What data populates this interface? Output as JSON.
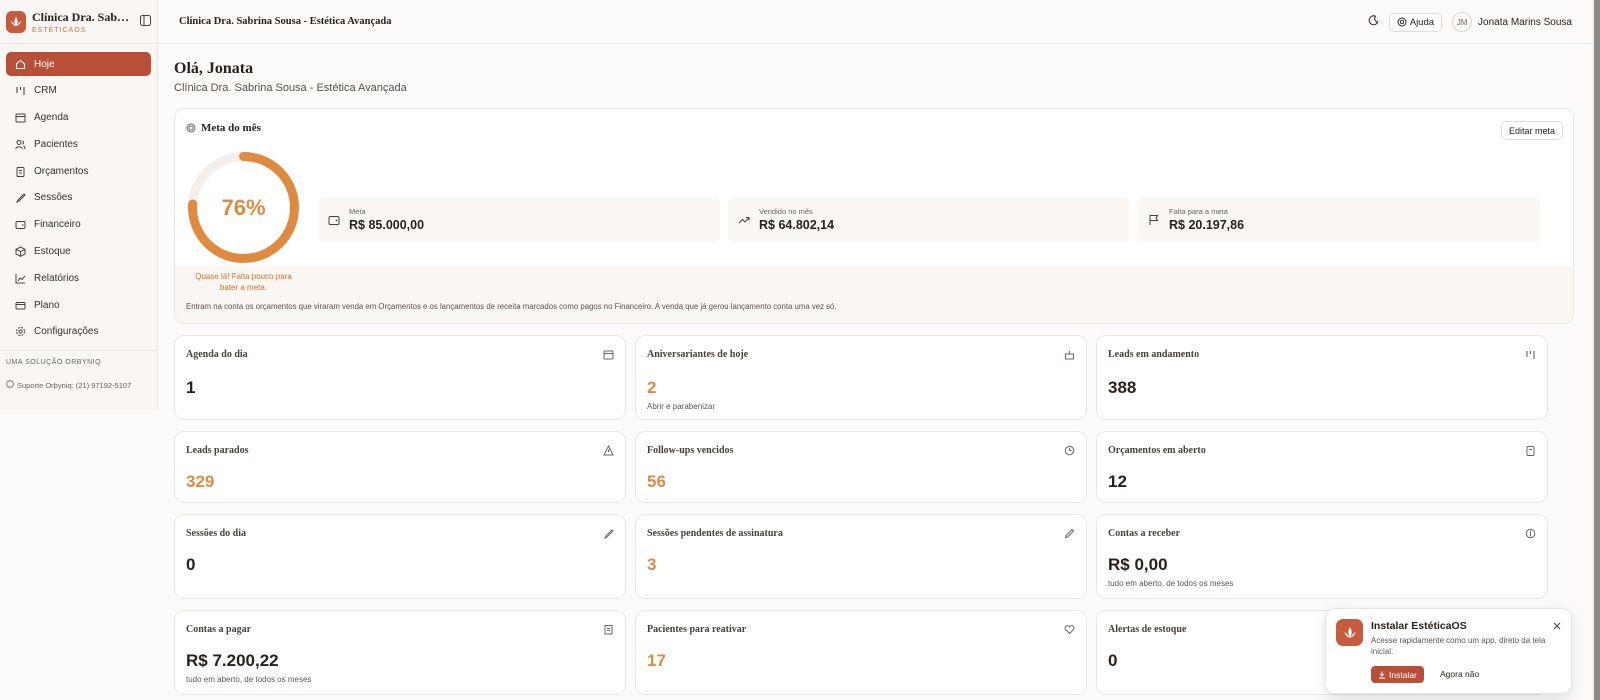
{
  "brand": {
    "name": "Clínica Dra. Sabrina Sousa",
    "sub": "ESTÉTICAOS"
  },
  "sidebar": {
    "items": [
      {
        "label": "Hoje",
        "icon": "home-icon",
        "active": true
      },
      {
        "label": "CRM",
        "icon": "kanban-icon"
      },
      {
        "label": "Agenda",
        "icon": "calendar-icon"
      },
      {
        "label": "Pacientes",
        "icon": "users-icon"
      },
      {
        "label": "Orçamentos",
        "icon": "clipboard-icon"
      },
      {
        "label": "Sessões",
        "icon": "syringe-icon"
      },
      {
        "label": "Financeiro",
        "icon": "wallet-icon"
      },
      {
        "label": "Estoque",
        "icon": "package-icon"
      },
      {
        "label": "Relatórios",
        "icon": "chart-icon"
      },
      {
        "label": "Plano",
        "icon": "credit-card-icon"
      },
      {
        "label": "Configurações",
        "icon": "gear-icon"
      }
    ],
    "footer_tag": "UMA SOLUÇÃO ORBYNIQ",
    "support": "Suporte Orbyniq: (21) 97192-5107"
  },
  "header": {
    "clinic": "Clínica Dra. Sabrina Sousa - Estética Avançada",
    "help": "Ajuda",
    "avatar": "JM",
    "user": "Jonata Marins Sousa"
  },
  "greeting": {
    "title": "Olá, Jonata",
    "subtitle": "Clínica Dra. Sabrina Sousa - Estética Avançada"
  },
  "goal": {
    "title": "Meta do mês",
    "edit": "Editar meta",
    "percent": 76,
    "percent_label": "76%",
    "note": "Quase lá! Falta pouco para bater a meta.",
    "stats": [
      {
        "label": "Meta",
        "value": "R$ 85.000,00",
        "icon": "wallet-icon"
      },
      {
        "label": "Vendido no mês",
        "value": "R$ 64.802,14",
        "icon": "trending-up-icon"
      },
      {
        "label": "Falta para a meta",
        "value": "R$ 20.197,86",
        "icon": "flag-icon"
      }
    ],
    "footnote": "Entram na conta os orçamentos que viraram venda em Orçamentos e os lançamentos de receita marcados como pagos no Financeiro. A venda que já gerou lançamento conta uma vez só.",
    "colors": {
      "ring": "#df8a3e",
      "track": "#f3eeea"
    }
  },
  "cards": [
    {
      "title": "Agenda do dia",
      "value": "1",
      "sub": "",
      "icon": "calendar-icon",
      "accent": false
    },
    {
      "title": "Aniversariantes de hoje",
      "value": "2",
      "sub": "Abrir e parabenizar",
      "icon": "cake-icon",
      "accent": true
    },
    {
      "title": "Leads em andamento",
      "value": "388",
      "sub": "",
      "icon": "kanban-icon",
      "accent": false
    },
    {
      "title": "Leads parados",
      "value": "329",
      "sub": "",
      "icon": "alert-triangle-icon",
      "accent": true
    },
    {
      "title": "Follow-ups vencidos",
      "value": "56",
      "sub": "",
      "icon": "clock-icon",
      "accent": true
    },
    {
      "title": "Orçamentos em aberto",
      "value": "12",
      "sub": "",
      "icon": "clipboard-icon",
      "accent": false
    },
    {
      "title": "Sessões do dia",
      "value": "0",
      "sub": "",
      "icon": "syringe-icon",
      "accent": false
    },
    {
      "title": "Sessões pendentes de assinatura",
      "value": "3",
      "sub": "",
      "icon": "pen-icon",
      "accent": true
    },
    {
      "title": "Contas a receber",
      "value": "R$ 0,00",
      "sub": "tudo em aberto, de todos os meses",
      "icon": "dollar-circle-icon",
      "accent": false
    },
    {
      "title": "Contas a pagar",
      "value": "R$ 7.200,22",
      "sub": "tudo em aberto, de todos os meses",
      "icon": "receipt-icon",
      "accent": false
    },
    {
      "title": "Pacientes para reativar",
      "value": "17",
      "sub": "",
      "icon": "heart-icon",
      "accent": true
    },
    {
      "title": "Alertas de estoque",
      "value": "0",
      "sub": "",
      "icon": "package-icon",
      "accent": false
    }
  ],
  "install": {
    "title": "Instalar EstéticaOS",
    "desc": "Acesse rapidamente como um app, direto da tela inicial.",
    "install": "Instalar",
    "later": "Agora não"
  },
  "colors": {
    "brand": "#b84f36",
    "accent": "#df8a3e"
  }
}
